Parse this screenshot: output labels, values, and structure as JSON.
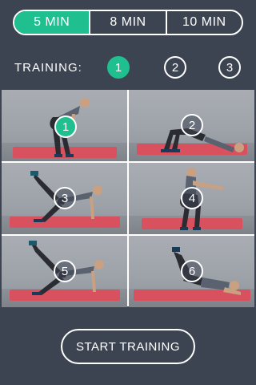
{
  "duration": {
    "options": [
      {
        "label": "5 MIN",
        "active": true
      },
      {
        "label": "8 MIN",
        "active": false
      },
      {
        "label": "10 MIN",
        "active": false
      }
    ]
  },
  "training": {
    "label": "TRAINING:",
    "options": [
      "1",
      "2",
      "3"
    ],
    "selected": "1"
  },
  "exercises": [
    {
      "number": "1",
      "active": true
    },
    {
      "number": "2",
      "active": false
    },
    {
      "number": "3",
      "active": false
    },
    {
      "number": "4",
      "active": false
    },
    {
      "number": "5",
      "active": false
    },
    {
      "number": "6",
      "active": false
    }
  ],
  "start_button": {
    "label": "START TRAINING"
  },
  "colors": {
    "accent": "#1fbf8f",
    "background": "#3c4452",
    "mat": "#d9505f"
  }
}
